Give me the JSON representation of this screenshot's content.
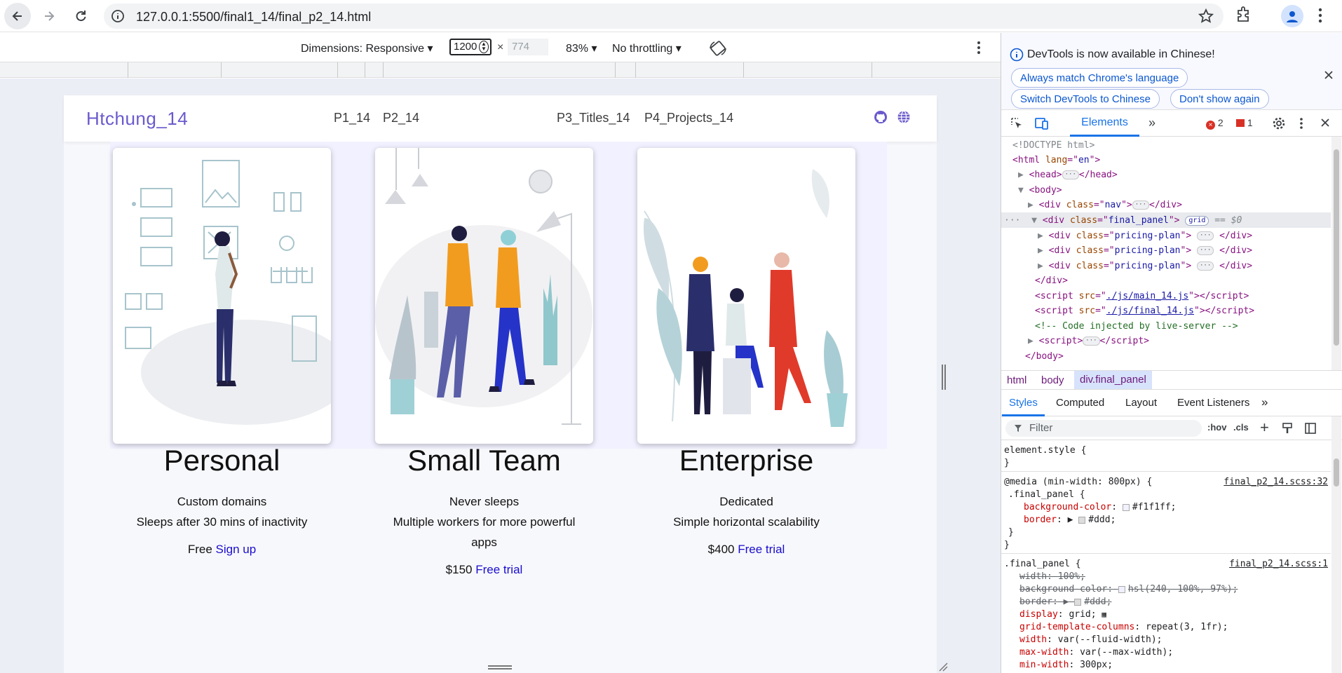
{
  "browser": {
    "url": "127.0.0.1:5500/final1_14/final_p2_14.html"
  },
  "device_toolbar": {
    "dimensions": "Dimensions: Responsive ▾",
    "width_value": "1200",
    "times": "×",
    "height_value": "774",
    "zoom": "83% ▾",
    "throttling": "No throttling ▾"
  },
  "page": {
    "logo": "Htchung_14",
    "nav_links": [
      "P1_14",
      "P2_14",
      "P3_Titles_14",
      "P4_Projects_14"
    ],
    "plans": [
      {
        "title": "Personal",
        "feature1": "Custom domains",
        "feature2": "Sleeps after 30 mins of inactivity",
        "price": "Free",
        "cta": "Sign up"
      },
      {
        "title": "Small Team",
        "feature1": "Never sleeps",
        "feature2": "Multiple workers for more powerful apps",
        "price": "$150",
        "cta": "Free trial"
      },
      {
        "title": "Enterprise",
        "feature1": "Dedicated",
        "feature2": "Simple horizontal scalability",
        "price": "$400",
        "cta": "Free trial"
      }
    ]
  },
  "devtools": {
    "notice": "DevTools is now available in Chinese!",
    "pills": [
      "Always match Chrome's language",
      "Switch DevTools to Chinese",
      "Don't show again"
    ],
    "tab_active": "Elements",
    "errors": "2",
    "warnings": "1",
    "dom": {
      "doctype": "<!DOCTYPE html>",
      "html_lang": "en",
      "nav_class": "nav",
      "panel_class": "final_panel",
      "plan_class": "pricing-plan",
      "grid_badge": "grid",
      "selected_marker": "== $0",
      "script1": "./js/main_14.js",
      "script2": "./js/final_14.js",
      "comment": "<!-- Code injected by live-server -->"
    },
    "breadcrumbs": [
      "html",
      "body",
      "div.final_panel"
    ],
    "style_tabs": [
      "Styles",
      "Computed",
      "Layout",
      "Event Listeners"
    ],
    "filter_placeholder": "Filter",
    "hov": ":hov",
    "cls": ".cls",
    "styles": {
      "element_style": "element.style {",
      "close_brace": "}",
      "media": "@media (min-width: 800px) {",
      "media_source": "final_p2_14.scss:32",
      "selector": ".final_panel {",
      "bg_prop": "background-color",
      "bg_val": "#f1f1ff;",
      "border_prop": "border",
      "border_val": "#ddd;",
      "rule_source": "final_p2_14.scss:1",
      "width_decl": "width: 100%;",
      "bg2_decl": "background-color:",
      "bg2_val": "hsl(240, 100%, 97%);",
      "border2_decl": "border:",
      "border2_val": "#ddd;",
      "display_prop": "display",
      "display_val": "grid;",
      "gtc_prop": "grid-template-columns",
      "gtc_val": "repeat(3, 1fr);",
      "width_prop": "width",
      "width_val": "var(--fluid-width);",
      "maxw_prop": "max-width",
      "maxw_val": "var(--max-width);",
      "minw_prop": "min-width",
      "minw_val": "300px;"
    }
  },
  "colors": {
    "accent": "#1a73e8",
    "logo": "#6a5acd",
    "panel_bg": "#f1f1ff",
    "link": "#1a0dcc"
  }
}
